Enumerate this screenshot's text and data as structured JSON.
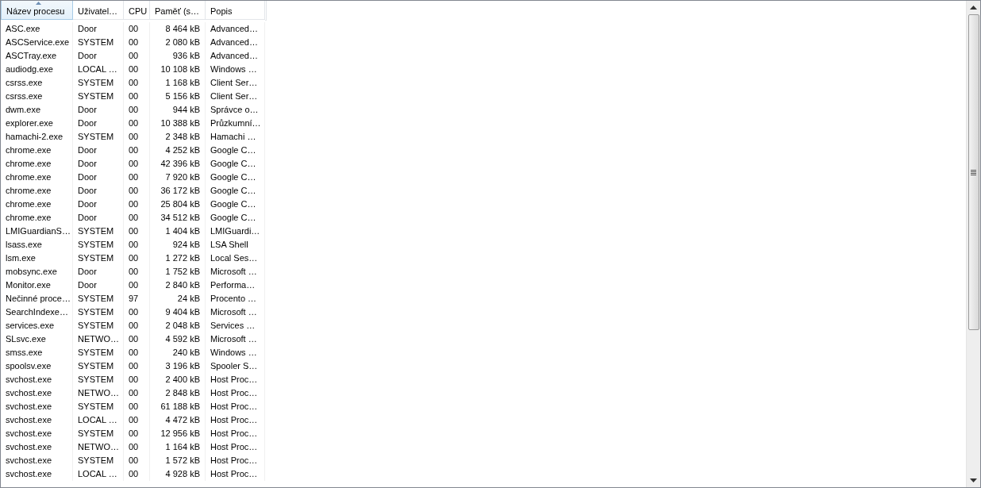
{
  "table": {
    "columns": [
      {
        "label": "Název procesu",
        "sorted": true
      },
      {
        "label": "Uživatel…",
        "sorted": false
      },
      {
        "label": "CPU",
        "sorted": false
      },
      {
        "label": "Paměť (s…",
        "sorted": false
      },
      {
        "label": "Popis",
        "sorted": false
      }
    ],
    "rows": [
      [
        "ASC.exe",
        "Door",
        "00",
        "8 464 kB",
        "Advanced…"
      ],
      [
        "ASCService.exe",
        "SYSTEM",
        "00",
        "2 080 kB",
        "Advanced…"
      ],
      [
        "ASCTray.exe",
        "Door",
        "00",
        "936 kB",
        "Advanced…"
      ],
      [
        "audiodg.exe",
        "LOCAL …",
        "00",
        "10 108 kB",
        "Windows …"
      ],
      [
        "csrss.exe",
        "SYSTEM",
        "00",
        "1 168 kB",
        "Client Ser…"
      ],
      [
        "csrss.exe",
        "SYSTEM",
        "00",
        "5 156 kB",
        "Client Ser…"
      ],
      [
        "dwm.exe",
        "Door",
        "00",
        "944 kB",
        "Správce o…"
      ],
      [
        "explorer.exe",
        "Door",
        "00",
        "10 388 kB",
        "Průzkumní…"
      ],
      [
        "hamachi-2.exe",
        "SYSTEM",
        "00",
        "2 348 kB",
        "Hamachi …"
      ],
      [
        "chrome.exe",
        "Door",
        "00",
        "4 252 kB",
        "Google C…"
      ],
      [
        "chrome.exe",
        "Door",
        "00",
        "42 396 kB",
        "Google C…"
      ],
      [
        "chrome.exe",
        "Door",
        "00",
        "7 920 kB",
        "Google C…"
      ],
      [
        "chrome.exe",
        "Door",
        "00",
        "36 172 kB",
        "Google C…"
      ],
      [
        "chrome.exe",
        "Door",
        "00",
        "25 804 kB",
        "Google C…"
      ],
      [
        "chrome.exe",
        "Door",
        "00",
        "34 512 kB",
        "Google C…"
      ],
      [
        "LMIGuardianS…",
        "SYSTEM",
        "00",
        "1 404 kB",
        "LMIGuardi…"
      ],
      [
        "lsass.exe",
        "SYSTEM",
        "00",
        "924 kB",
        "LSA Shell"
      ],
      [
        "lsm.exe",
        "SYSTEM",
        "00",
        "1 272 kB",
        "Local Ses…"
      ],
      [
        "mobsync.exe",
        "Door",
        "00",
        "1 752 kB",
        "Microsoft …"
      ],
      [
        "Monitor.exe",
        "Door",
        "00",
        "2 840 kB",
        "Performa…"
      ],
      [
        "Nečinné proce…",
        "SYSTEM",
        "97",
        "24 kB",
        "Procento …"
      ],
      [
        "SearchIndexe…",
        "SYSTEM",
        "00",
        "9 404 kB",
        "Microsoft …"
      ],
      [
        "services.exe",
        "SYSTEM",
        "00",
        "2 048 kB",
        "Services …"
      ],
      [
        "SLsvc.exe",
        "NETWO…",
        "00",
        "4 592 kB",
        "Microsoft …"
      ],
      [
        "smss.exe",
        "SYSTEM",
        "00",
        "240 kB",
        "Windows …"
      ],
      [
        "spoolsv.exe",
        "SYSTEM",
        "00",
        "3 196 kB",
        "Spooler S…"
      ],
      [
        "svchost.exe",
        "SYSTEM",
        "00",
        "2 400 kB",
        "Host Proc…"
      ],
      [
        "svchost.exe",
        "NETWO…",
        "00",
        "2 848 kB",
        "Host Proc…"
      ],
      [
        "svchost.exe",
        "SYSTEM",
        "00",
        "61 188 kB",
        "Host Proc…"
      ],
      [
        "svchost.exe",
        "LOCAL …",
        "00",
        "4 472 kB",
        "Host Proc…"
      ],
      [
        "svchost.exe",
        "SYSTEM",
        "00",
        "12 956 kB",
        "Host Proc…"
      ],
      [
        "svchost.exe",
        "NETWO…",
        "00",
        "1 164 kB",
        "Host Proc…"
      ],
      [
        "svchost.exe",
        "SYSTEM",
        "00",
        "1 572 kB",
        "Host Proc…"
      ],
      [
        "svchost.exe",
        "LOCAL …",
        "00",
        "4 928 kB",
        "Host Proc…"
      ]
    ]
  }
}
